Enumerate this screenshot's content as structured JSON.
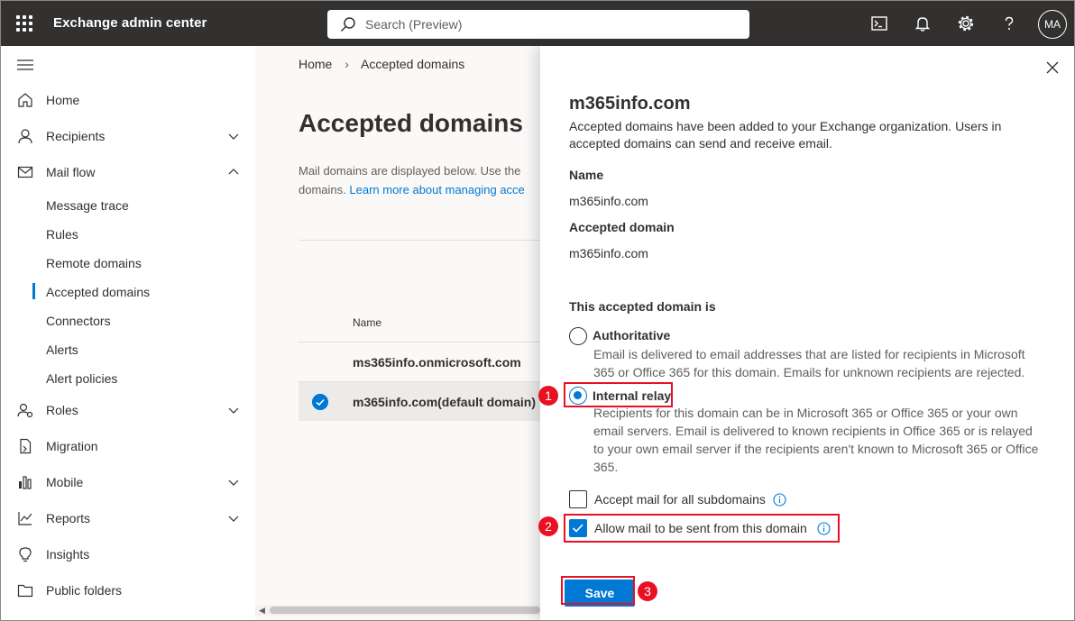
{
  "topbar": {
    "app_title": "Exchange admin center",
    "search_placeholder": "Search (Preview)",
    "avatar_initials": "MA",
    "icons": [
      "waffle-icon",
      "terminal-icon",
      "bell-icon",
      "gear-icon",
      "help-icon"
    ]
  },
  "nav": {
    "items": [
      {
        "label": "Home",
        "icon": "home-icon"
      },
      {
        "label": "Recipients",
        "icon": "person-icon",
        "expandable": true
      },
      {
        "label": "Mail flow",
        "icon": "mail-icon",
        "expanded": true
      },
      {
        "label": "Roles",
        "icon": "roles-icon",
        "expandable": true
      },
      {
        "label": "Migration",
        "icon": "migration-icon"
      },
      {
        "label": "Mobile",
        "icon": "mobile-icon",
        "expandable": true
      },
      {
        "label": "Reports",
        "icon": "reports-icon",
        "expandable": true
      },
      {
        "label": "Insights",
        "icon": "lightbulb-icon"
      },
      {
        "label": "Public folders",
        "icon": "folder-icon"
      }
    ],
    "mailflow_sub": [
      "Message trace",
      "Rules",
      "Remote domains",
      "Accepted domains",
      "Connectors",
      "Alerts",
      "Alert policies"
    ],
    "active_sub": "Accepted domains"
  },
  "main": {
    "breadcrumb": {
      "home": "Home",
      "current": "Accepted domains"
    },
    "page_title": "Accepted domains",
    "desc_line1": "Mail domains are displayed below. Use the",
    "desc_line2": "domains.",
    "desc_link": "Learn more about managing acce",
    "column_name": "Name",
    "rows": [
      "ms365info.onmicrosoft.com",
      "m365info.com(default domain)"
    ],
    "selected_row": 1
  },
  "panel": {
    "title": "m365info.com",
    "description": "Accepted domains have been added to your Exchange organization. Users in accepted domains can send and receive email.",
    "name_label": "Name",
    "name_value": "m365info.com",
    "domain_label": "Accepted domain",
    "domain_value": "m365info.com",
    "type_label": "This accepted domain is",
    "authoritative_label": "Authoritative",
    "authoritative_desc": "Email is delivered to email addresses that are listed for recipients in Microsoft 365 or Office 365 for this domain. Emails for unknown recipients are rejected.",
    "relay_label": "Internal relay",
    "relay_desc": "Recipients for this domain can be in Microsoft 365 or Office 365 or your own email servers. Email is delivered to known recipients in Office 365 or is relayed to your own email server if the recipients aren't known to Microsoft 365 or Office 365.",
    "selected_type": "Internal relay",
    "subdomains_label": "Accept mail for all subdomains",
    "subdomains_checked": false,
    "send_from_label": "Allow mail to be sent from this domain",
    "send_from_checked": true,
    "save_label": "Save"
  },
  "annotations": [
    "1",
    "2",
    "3"
  ],
  "colors": {
    "accent": "#0078d4",
    "topbar": "#323130",
    "annotation": "#e81123"
  }
}
